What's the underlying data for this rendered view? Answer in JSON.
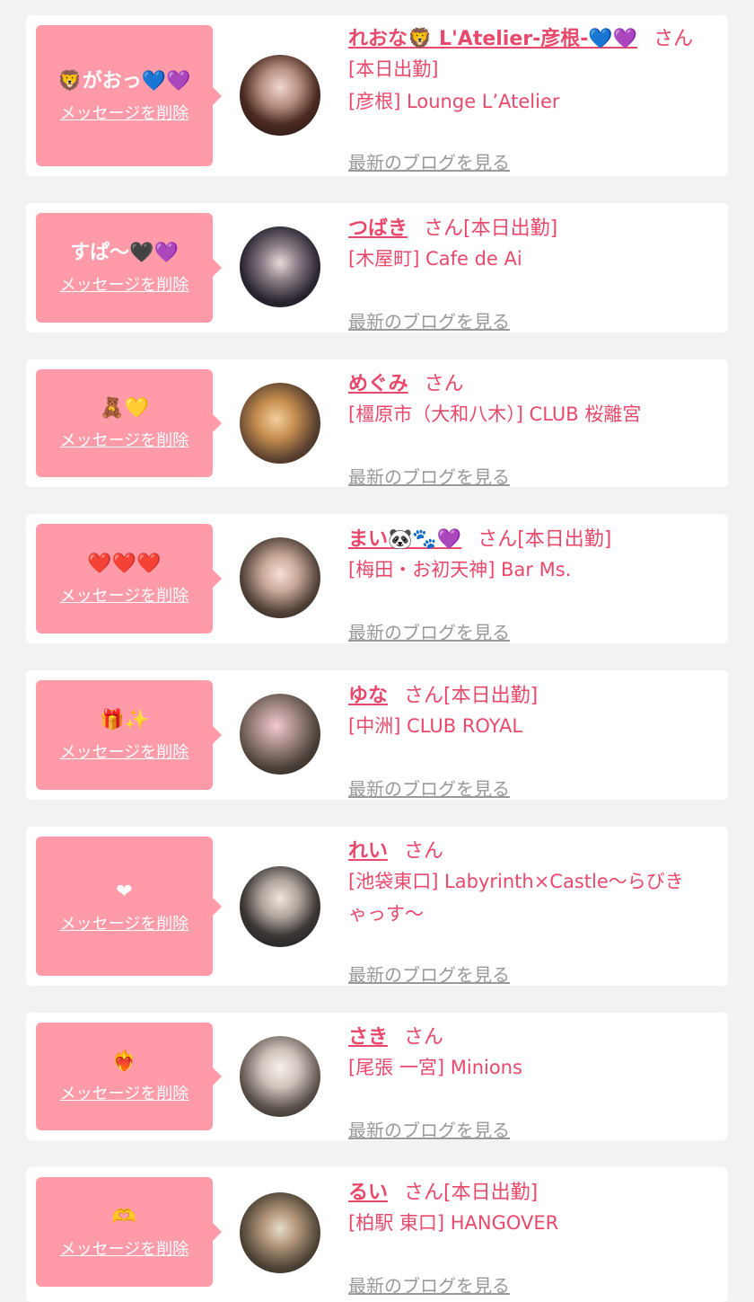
{
  "delete_label": "メッセージを削除",
  "blog_label": "最新のブログを見る",
  "san_label": "さん",
  "colors": {
    "accent": "#e8496b",
    "bubble": "#ff9aa8",
    "muted": "#999999"
  },
  "cards": [
    {
      "bubble_msg": "🦁がおっ💙💜",
      "name": "れおな🦁 L'Atelier-彦根-💙💜",
      "status": "",
      "status_line": "[本日出勤]",
      "store": "[彦根] Lounge L’Atelier",
      "store2": ""
    },
    {
      "bubble_msg": "すぱ〜🖤💜",
      "name": "つばき",
      "status": "[本日出勤]",
      "status_line": "",
      "store": "[木屋町] Cafe de Ai",
      "store2": ""
    },
    {
      "bubble_msg": "🧸💛",
      "name": "めぐみ",
      "status": "",
      "status_line": "",
      "store": "[橿原市（大和八木）] CLUB 桜離宮",
      "store2": ""
    },
    {
      "bubble_msg": "❤️❤️❤️",
      "name": "まい🐼🐾💜",
      "status": "[本日出勤]",
      "status_line": "",
      "store": "[梅田・お初天神] Bar Ms.",
      "store2": ""
    },
    {
      "bubble_msg": "🎁✨",
      "name": "ゆな",
      "status": "[本日出勤]",
      "status_line": "",
      "store": "[中洲] CLUB ROYAL",
      "store2": ""
    },
    {
      "bubble_msg": "❤",
      "name": "れい",
      "status": "",
      "status_line": "",
      "store": "[池袋東口] Labyrinth×Castle〜らびき",
      "store2": "ゃっす〜"
    },
    {
      "bubble_msg": "❤️‍🔥",
      "name": "さき",
      "status": "",
      "status_line": "",
      "store": "[尾張 一宮] Minions",
      "store2": ""
    },
    {
      "bubble_msg": "🫶",
      "name": "るい",
      "status": "[本日出勤]",
      "status_line": "",
      "store": "[柏駅 東口] HANGOVER",
      "store2": ""
    }
  ]
}
